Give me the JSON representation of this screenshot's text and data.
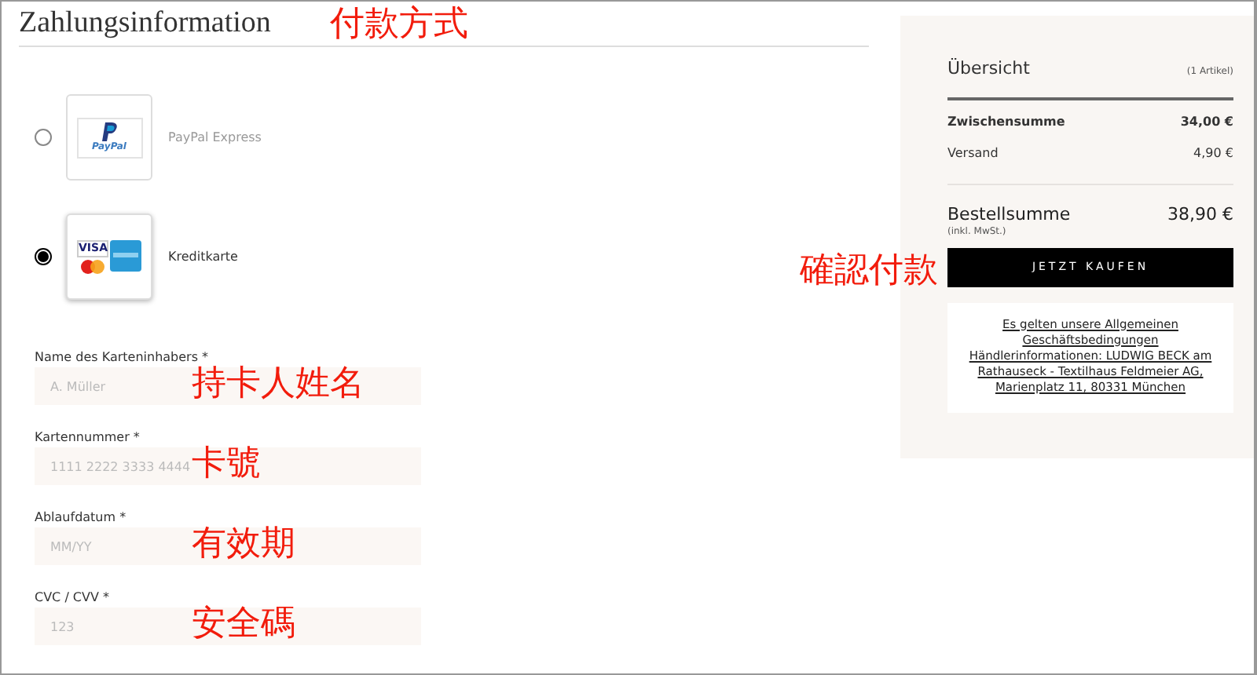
{
  "header": {
    "title": "Zahlungsinformation",
    "annotation": "付款方式"
  },
  "payment_methods": [
    {
      "label": "PayPal Express",
      "kind": "paypal",
      "logo_text": "PayPal",
      "selected": false
    },
    {
      "label": "Kreditkarte",
      "kind": "card",
      "logo_text": "VISA",
      "selected": true
    }
  ],
  "fields": [
    {
      "label": "Name des Karteninhabers *",
      "placeholder": "A. Müller",
      "annotation": "持卡人姓名"
    },
    {
      "label": "Kartennummer *",
      "placeholder": "1111 2222 3333 4444",
      "annotation": "卡號"
    },
    {
      "label": "Ablaufdatum *",
      "placeholder": "MM/YY",
      "annotation": "有效期"
    },
    {
      "label": "CVC / CVV *",
      "placeholder": "123",
      "annotation": "安全碼"
    }
  ],
  "summary": {
    "title": "Übersicht",
    "count": "(1 Artikel)",
    "lines": [
      {
        "label": "Zwischensumme",
        "value": "34,00 €",
        "kind": "bold"
      },
      {
        "label": "Versand",
        "value": "4,90 €",
        "kind": "plain"
      }
    ],
    "total_label": "Bestellsumme",
    "total_value": "38,90 €",
    "tax_note": "(inkl. MwSt.)",
    "button": "JETZT KAUFEN",
    "button_annotation": "確認付款",
    "links": [
      "Es gelten unsere Allgemeinen Geschäftsbedingungen",
      "Händlerinformationen: LUDWIG BECK am Rathauseck - Textilhaus Feldmeier AG, Marienplatz 11, 80331 München"
    ]
  }
}
